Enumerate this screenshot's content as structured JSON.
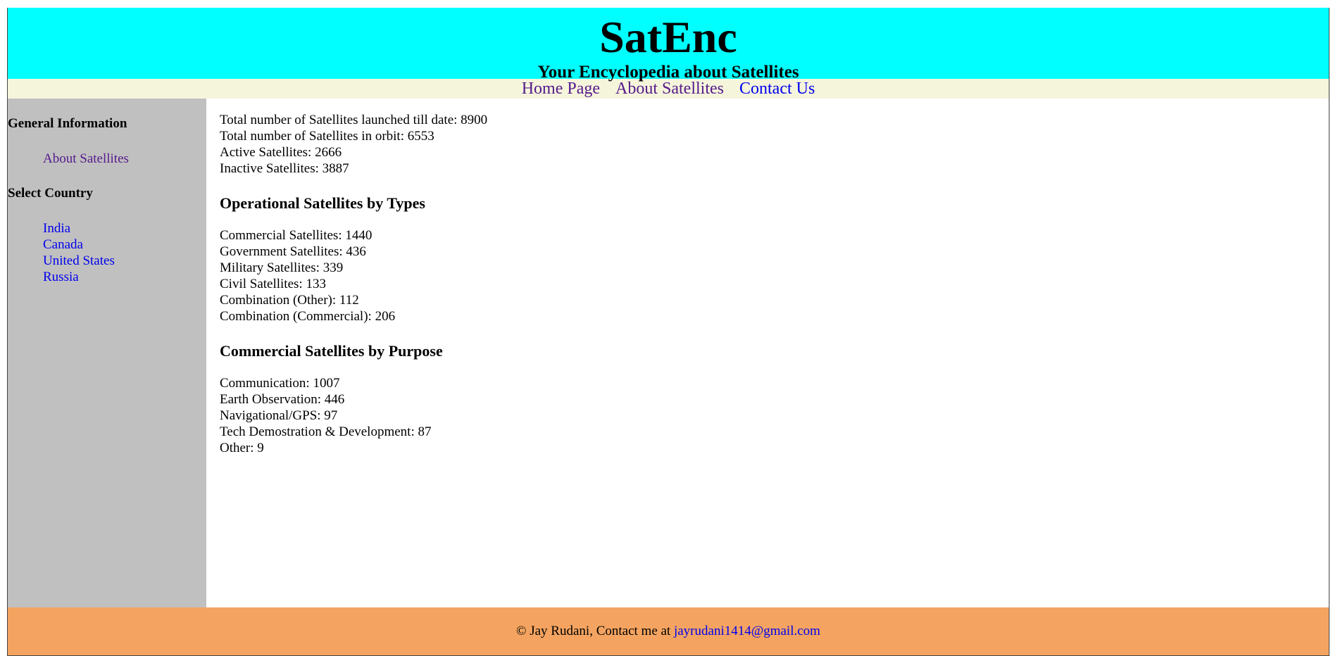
{
  "header": {
    "title": "SatEnc",
    "subtitle": "Your Encyclopedia about Satellites"
  },
  "nav": {
    "home": "Home Page",
    "about": "About Satellites",
    "contact": "Contact Us"
  },
  "sidebar": {
    "general_heading": "General Information",
    "general_items": [
      "About Satellites"
    ],
    "country_heading": "Select Country",
    "countries": [
      "India",
      "Canada",
      "United States",
      "Russia"
    ]
  },
  "main": {
    "totals": [
      "Total number of Satellites launched till date: 8900",
      "Total number of Satellites in orbit: 6553",
      "Active Satellites: 2666",
      "Inactive Satellites: 3887"
    ],
    "types_heading": "Operational Satellites by Types",
    "types": [
      "Commercial Satellites: 1440",
      "Government Satellites: 436",
      "Military Satellites: 339",
      "Civil Satellites: 133",
      "Combination (Other): 112",
      "Combination (Commercial): 206"
    ],
    "purpose_heading": "Commercial Satellites by Purpose",
    "purposes": [
      "Communication: 1007",
      "Earth Observation: 446",
      "Navigational/GPS: 97",
      "Tech Demostration & Development: 87",
      "Other: 9"
    ]
  },
  "footer": {
    "text": "© Jay Rudani, Contact me at",
    "email": "jayrudani1414@gmail.com"
  },
  "colors": {
    "header_bg": "#00ffff",
    "nav_bg": "#f5f5dc",
    "sidebar_bg": "#c0c0c0",
    "footer_bg": "#f4a460"
  }
}
